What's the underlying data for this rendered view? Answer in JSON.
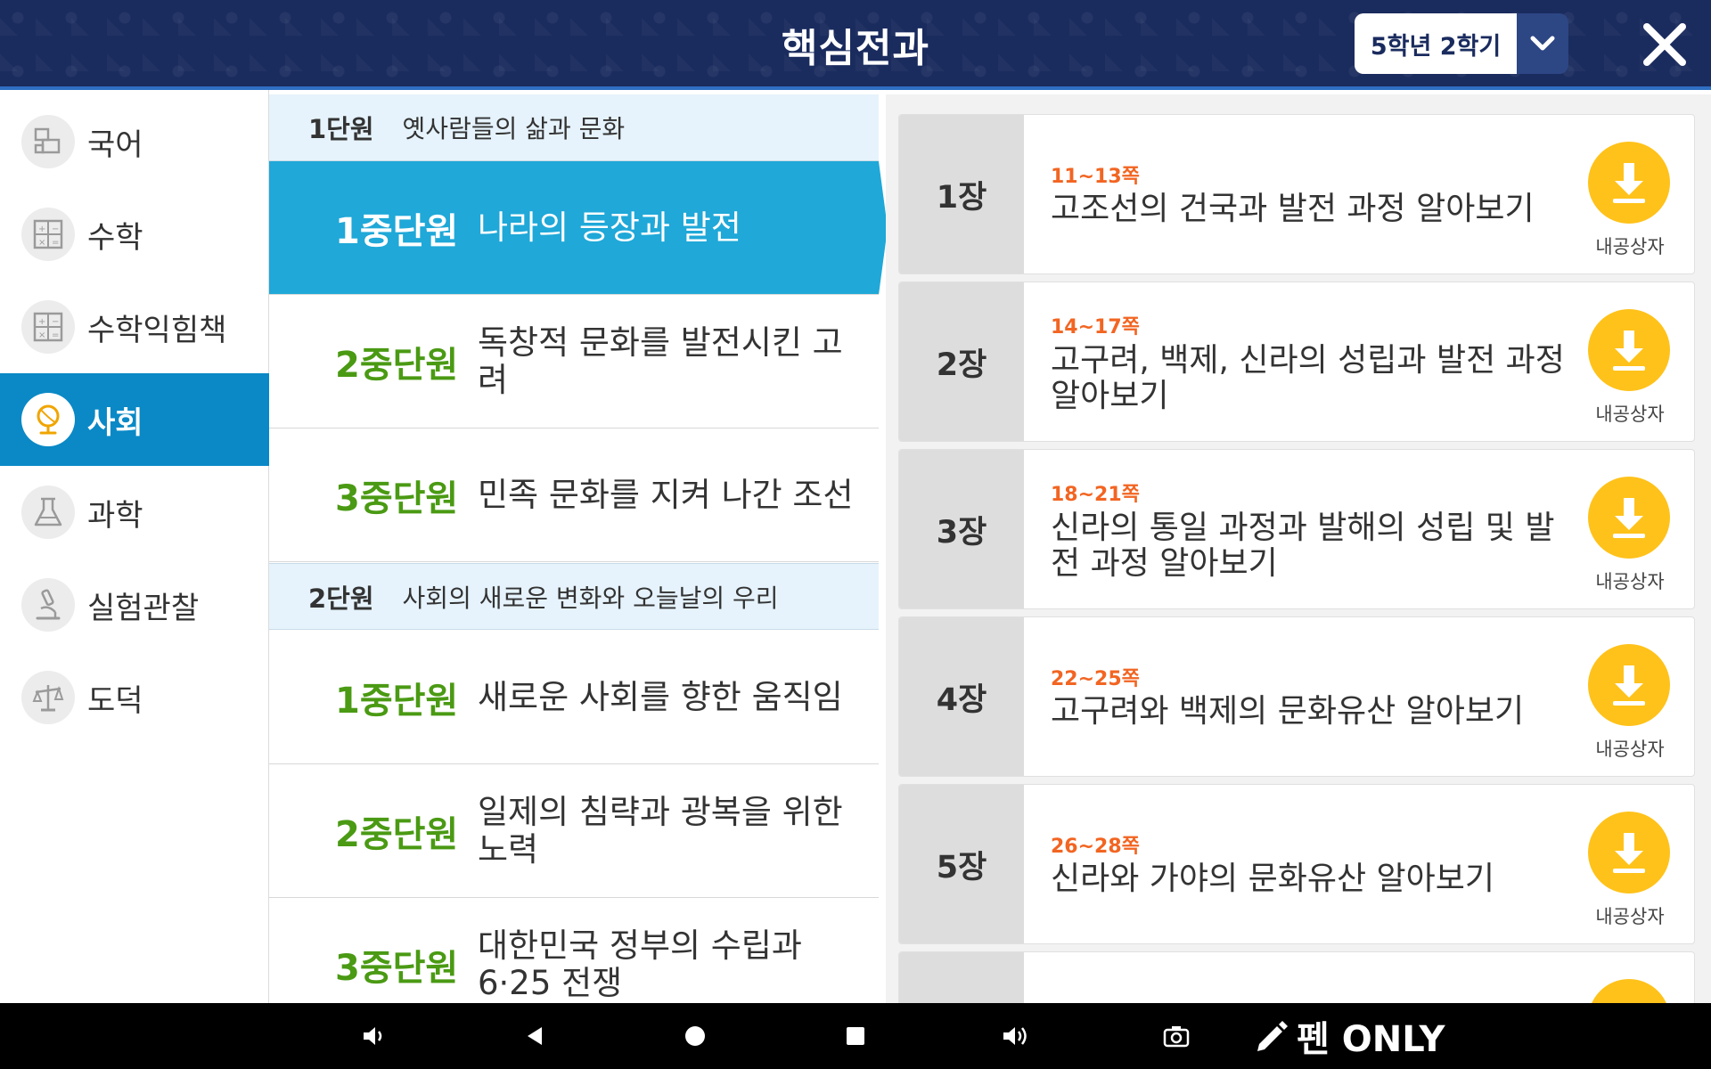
{
  "header": {
    "title": "핵심전과",
    "grade_select": "5학년 2학기"
  },
  "sidebar": {
    "items": [
      {
        "label": "국어",
        "icon": "language-book-icon",
        "active": false
      },
      {
        "label": "수학",
        "icon": "calculator-icon",
        "active": false
      },
      {
        "label": "수학익힘책",
        "icon": "calculator-icon",
        "active": false
      },
      {
        "label": "사회",
        "icon": "globe-icon",
        "active": true
      },
      {
        "label": "과학",
        "icon": "flask-icon",
        "active": false
      },
      {
        "label": "실험관찰",
        "icon": "microscope-icon",
        "active": false
      },
      {
        "label": "도덕",
        "icon": "scale-icon",
        "active": false
      }
    ]
  },
  "units": [
    {
      "unit_no": "1단원",
      "unit_title": "옛사람들의 삶과 문화",
      "subs": [
        {
          "no": "1중단원",
          "title": "나라의 등장과 발전",
          "active": true
        },
        {
          "no": "2중단원",
          "title": "독창적 문화를 발전시킨 고려",
          "active": false
        },
        {
          "no": "3중단원",
          "title": "민족 문화를 지켜 나간 조선",
          "active": false
        }
      ]
    },
    {
      "unit_no": "2단원",
      "unit_title": "사회의 새로운 변화와 오늘날의 우리",
      "subs": [
        {
          "no": "1중단원",
          "title": "새로운 사회를 향한 움직임",
          "active": false
        },
        {
          "no": "2중단원",
          "title": "일제의 침략과 광복을 위한 노력",
          "active": false
        },
        {
          "no": "3중단원",
          "title": "대한민국 정부의 수립과 6·25 전쟁",
          "active": false
        }
      ]
    }
  ],
  "chapters": [
    {
      "no": "1장",
      "pages": "11~13쪽",
      "title": "고조선의 건국과 발전 과정 알아보기",
      "download_label": "내공상자"
    },
    {
      "no": "2장",
      "pages": "14~17쪽",
      "title": "고구려, 백제, 신라의 성립과 발전 과정 알아보기",
      "download_label": "내공상자"
    },
    {
      "no": "3장",
      "pages": "18~21쪽",
      "title": "신라의 통일 과정과 발해의 성립 및 발전 과정 알아보기",
      "download_label": "내공상자"
    },
    {
      "no": "4장",
      "pages": "22~25쪽",
      "title": "고구려와 백제의 문화유산 알아보기",
      "download_label": "내공상자"
    },
    {
      "no": "5장",
      "pages": "26~28쪽",
      "title": "신라와 가야의 문화유산 알아보기",
      "download_label": "내공상자"
    },
    {
      "no": "",
      "pages": "",
      "title": "",
      "download_label": ""
    }
  ],
  "navbar": {
    "pen_only": "펜 ONLY"
  },
  "colors": {
    "header_bg": "#1a2b5e",
    "sidebar_active": "#0a89c6",
    "sub_active": "#1fa8d8",
    "sub_number": "#4a9a13",
    "page_range": "#f26522",
    "download": "#ffc21a"
  }
}
